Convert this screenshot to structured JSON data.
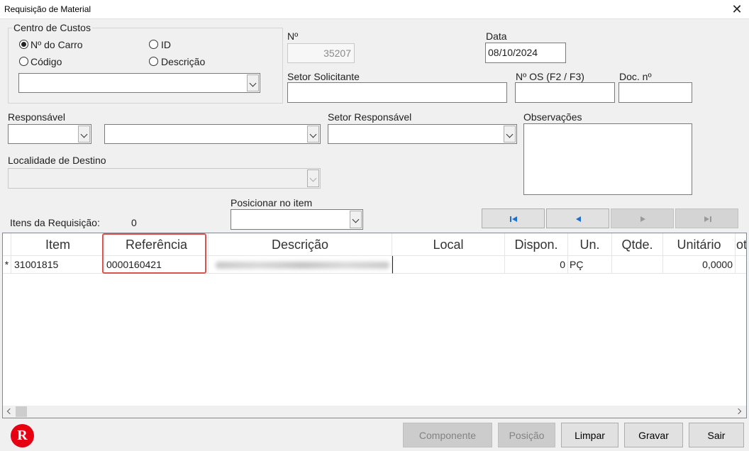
{
  "window": {
    "title": "Requisição de Material",
    "close_glyph": "✕"
  },
  "centro_custos": {
    "legend": "Centro de Custos",
    "options": [
      "Nº do Carro",
      "ID",
      "Código",
      "Descrição"
    ],
    "selected": "Nº do Carro",
    "combo_value": ""
  },
  "numero": {
    "label": "Nº",
    "value": "35207"
  },
  "data": {
    "label": "Data",
    "value": "08/10/2024"
  },
  "setor_solicitante": {
    "label": "Setor Solicitante",
    "value": ""
  },
  "num_os": {
    "label": "Nº OS (F2 / F3)",
    "value": ""
  },
  "doc_num": {
    "label": "Doc. nº",
    "value": ""
  },
  "responsavel": {
    "label": "Responsável",
    "code": "",
    "name": ""
  },
  "setor_responsavel": {
    "label": "Setor Responsável",
    "value": ""
  },
  "observacoes": {
    "label": "Observações",
    "value": ""
  },
  "localidade_destino": {
    "label": "Localidade de Destino",
    "value": ""
  },
  "itens": {
    "label": "Itens da Requisição:",
    "count": "0"
  },
  "posicionar": {
    "label": "Posicionar no item",
    "value": ""
  },
  "nav_icons": [
    "first-record-icon",
    "previous-record-icon",
    "next-record-icon",
    "last-record-icon"
  ],
  "grid": {
    "columns": [
      "Item",
      "Referência",
      "Descrição",
      "Local",
      "Dispon.",
      "Un.",
      "Qtde.",
      "Unitário",
      "ot"
    ],
    "rows": [
      {
        "marker": "*",
        "item": "31001815",
        "referencia": "0000160421",
        "descricao": "",
        "local": "",
        "dispon": "0",
        "un": "PÇ",
        "qtde": "",
        "unitario": "0,0000"
      }
    ],
    "highlight_column": "Referência",
    "highlight_color": "#d9534f"
  },
  "buttons": {
    "componente": "Componente",
    "posicao": "Posição",
    "limpar": "Limpar",
    "gravar": "Gravar",
    "sair": "Sair"
  },
  "logo": {
    "letter": "R",
    "color": "#e60012"
  }
}
